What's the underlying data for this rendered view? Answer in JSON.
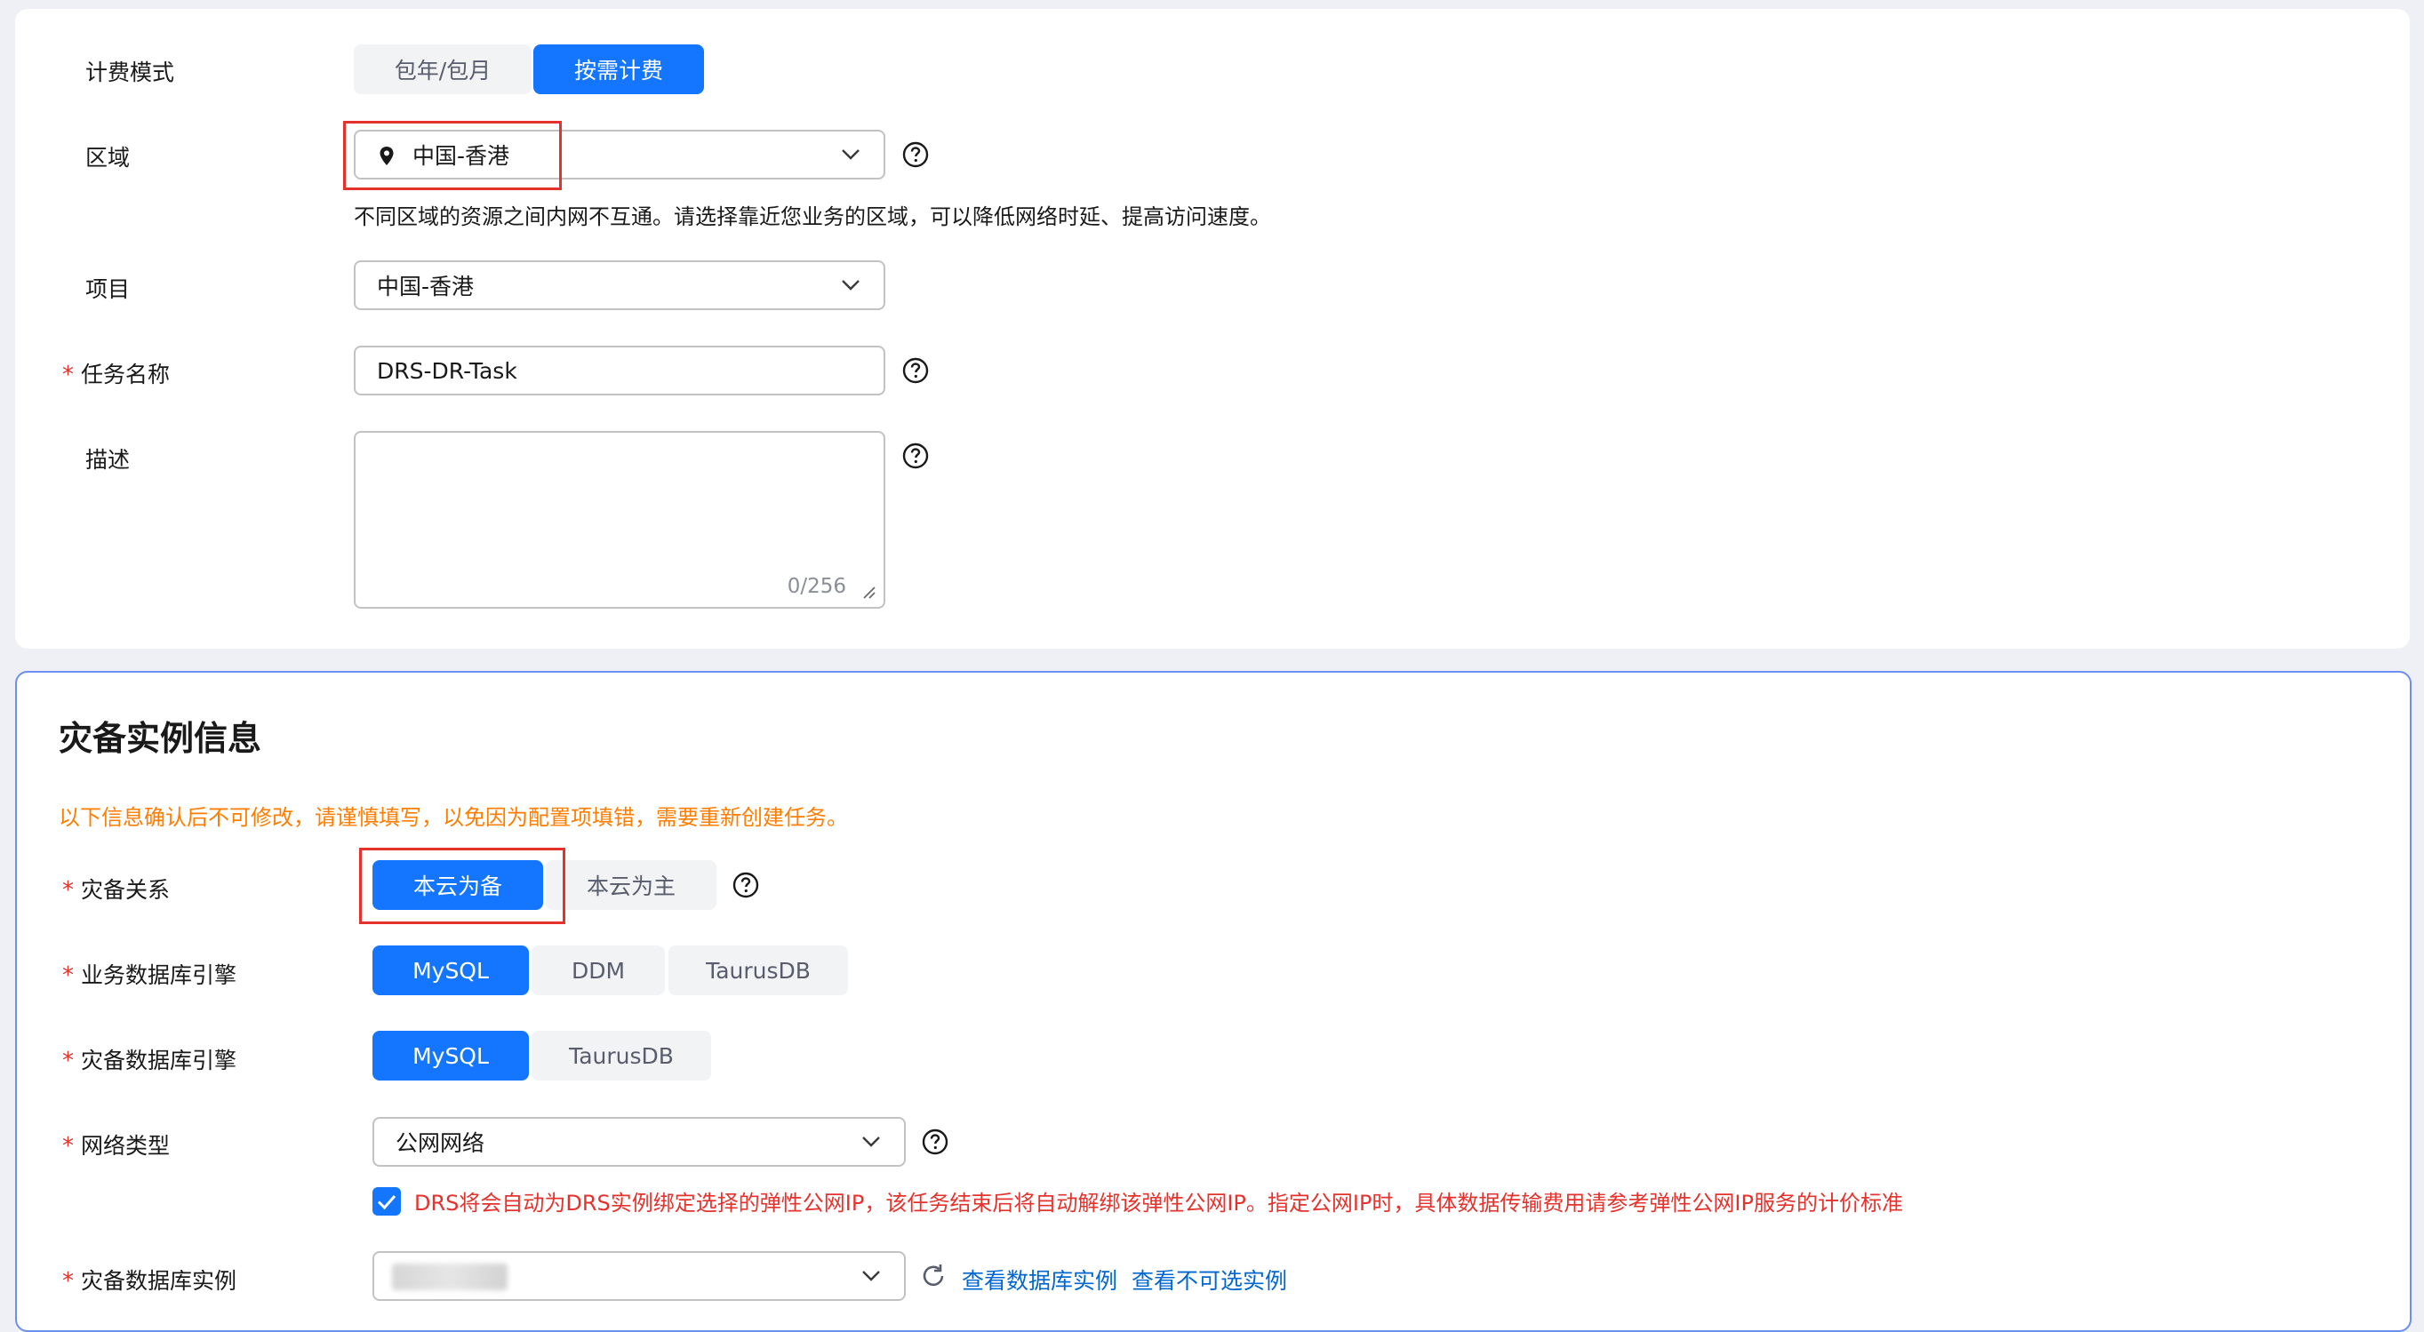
{
  "billing": {
    "label": "计费模式",
    "options": [
      "包年/包月",
      "按需计费"
    ],
    "selected": "按需计费"
  },
  "region": {
    "label": "区域",
    "value": "中国-香港",
    "hint": "不同区域的资源之间内网不互通。请选择靠近您业务的区域，可以降低网络时延、提高访问速度。"
  },
  "project": {
    "label": "项目",
    "value": "中国-香港"
  },
  "task_name": {
    "label": "任务名称",
    "value": "DRS-DR-Task"
  },
  "description": {
    "label": "描述",
    "value": "",
    "counter": "0/256"
  },
  "dr_section": {
    "title": "灾备实例信息",
    "warning": "以下信息确认后不可修改，请谨慎填写，以免因为配置项填错，需要重新创建任务。",
    "relation": {
      "label": "灾备关系",
      "options": [
        "本云为备",
        "本云为主"
      ],
      "selected": "本云为备"
    },
    "service_engine": {
      "label": "业务数据库引擎",
      "options": [
        "MySQL",
        "DDM",
        "TaurusDB"
      ],
      "selected": "MySQL"
    },
    "dr_engine": {
      "label": "灾备数据库引擎",
      "options": [
        "MySQL",
        "TaurusDB"
      ],
      "selected": "MySQL"
    },
    "network": {
      "label": "网络类型",
      "value": "公网网络",
      "checkbox_checked": true,
      "checkbox_text": "DRS将会自动为DRS实例绑定选择的弹性公网IP，该任务结束后将自动解绑该弹性公网IP。指定公网IP时，具体数据传输费用请参考弹性公网IP服务的计价标准"
    },
    "dr_instance": {
      "label": "灾备数据库实例",
      "link_view": "查看数据库实例",
      "link_unavailable": "查看不可选实例"
    }
  },
  "colors": {
    "primary": "#1476ff",
    "required": "#e5322d",
    "warning": "#ff7d00",
    "link": "#0067d1"
  }
}
